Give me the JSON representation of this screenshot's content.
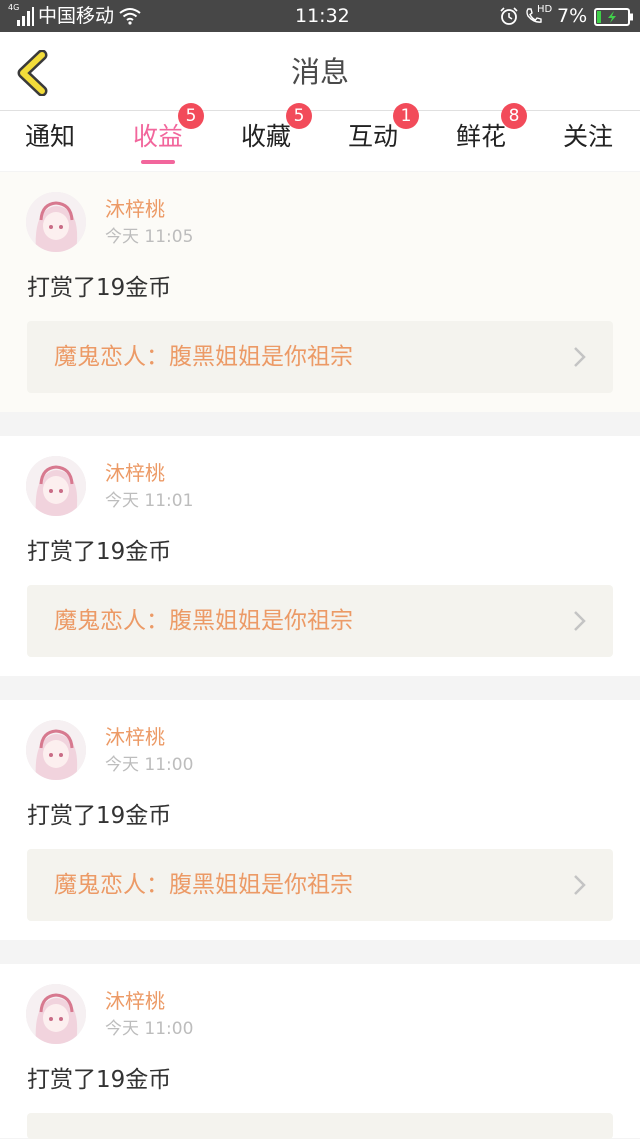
{
  "status_bar": {
    "network_type": "4G",
    "carrier": "中国移动",
    "time": "11:32",
    "hd_label": "HD",
    "battery": "7%",
    "icons": [
      "signal-icon",
      "wifi-icon",
      "alarm-icon",
      "hd-call-icon",
      "battery-charging-icon"
    ]
  },
  "header": {
    "title": "消息",
    "back_icon": "chevron-left-icon"
  },
  "tabs": [
    {
      "label": "通知",
      "badge": ""
    },
    {
      "label": "收益",
      "badge": "5",
      "active": true
    },
    {
      "label": "收藏",
      "badge": "5"
    },
    {
      "label": "互动",
      "badge": "1"
    },
    {
      "label": "鲜花",
      "badge": "8"
    },
    {
      "label": "关注",
      "badge": ""
    }
  ],
  "messages": [
    {
      "user": "沐梓桃",
      "time": "今天 11:05",
      "text": "打赏了19金币",
      "link": "魔鬼恋人：腹黑姐姐是你祖宗"
    },
    {
      "user": "沐梓桃",
      "time": "今天 11:01",
      "text": "打赏了19金币",
      "link": "魔鬼恋人：腹黑姐姐是你祖宗"
    },
    {
      "user": "沐梓桃",
      "time": "今天 11:00",
      "text": "打赏了19金币",
      "link": "魔鬼恋人：腹黑姐姐是你祖宗"
    },
    {
      "user": "沐梓桃",
      "time": "今天 11:00",
      "text": "打赏了19金币",
      "link": ""
    }
  ],
  "colors": {
    "accent_pink": "#f2669c",
    "badge_red": "#f24b5a",
    "name_orange": "#ec9a66",
    "status_bar_bg": "#474747",
    "back_icon_yellow": "#f2dc3a"
  }
}
